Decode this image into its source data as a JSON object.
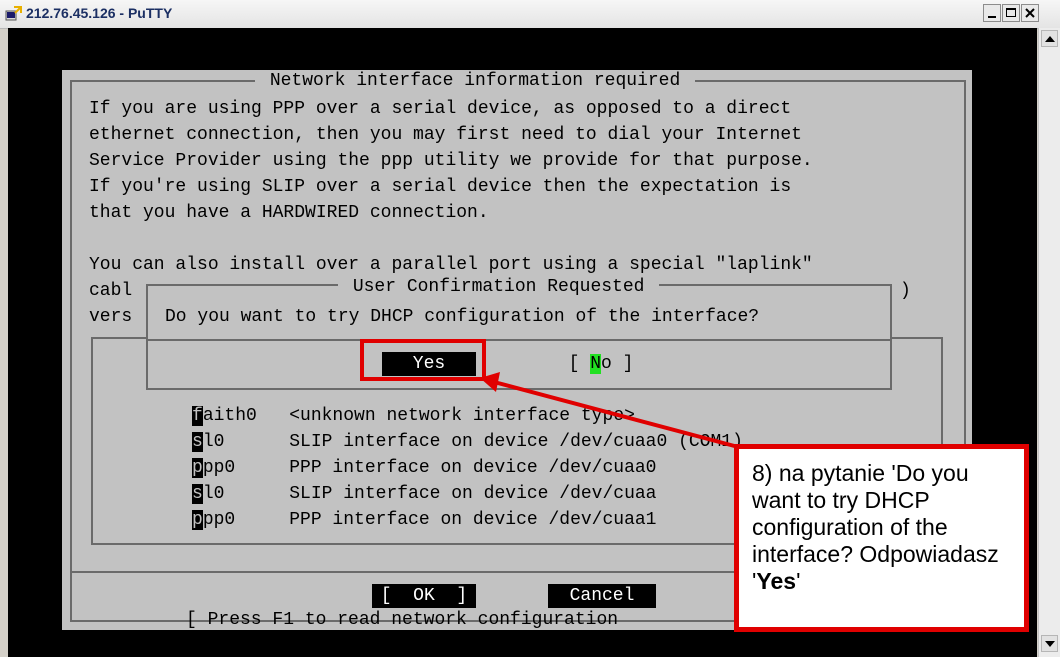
{
  "window": {
    "title": "212.76.45.126 - PuTTY"
  },
  "terminal": {
    "dialog_title": "Network interface information required",
    "intro_lines": [
      "If you are using PPP over a serial device, as opposed to a direct",
      "ethernet connection, then you may first need to dial your Internet",
      "Service Provider using the ppp utility we provide for that purpose.",
      "If you're using SLIP over a serial device then the expectation is",
      "that you have a HARDWIRED connection."
    ],
    "laplink_line": "You can also install over a parallel port using a special \"laplink\"",
    "cable_fragment": "cabl",
    "cable_close": ")",
    "vers_fragment": "vers",
    "interfaces": [
      {
        "key": "f",
        "rest": "aith0   <unknown network interface type>"
      },
      {
        "key": "s",
        "rest": "l0      SLIP interface on device /dev/cuaa0 (COM1)"
      },
      {
        "key": "p",
        "rest": "pp0     PPP interface on device /dev/cuaa0"
      },
      {
        "key": "s",
        "rest": "l0      SLIP interface on device /dev/cuaa"
      },
      {
        "key": "p",
        "rest": "pp0     PPP interface on device /dev/cuaa1"
      }
    ],
    "ok_label": "[  OK  ]",
    "cancel_label": "Cancel",
    "help_line": "[ Press F1 to read network configuration"
  },
  "popup": {
    "title": "User Confirmation Requested",
    "question": "Do you want to try DHCP configuration of the interface?",
    "yes_label": "Yes",
    "no_open": "[ ",
    "no_cursor": "N",
    "no_rest": "o ]"
  },
  "annotation": {
    "text_before": "8) na pytanie 'Do you want to try DHCP configuration of the interface? Odpowiadasz '",
    "text_bold": "Yes",
    "text_after": "'",
    "color": "#e00000"
  },
  "colors": {
    "terminal_bg": "#000000",
    "dialog_bg": "#c2c2c2",
    "cursor": "#22e022"
  }
}
